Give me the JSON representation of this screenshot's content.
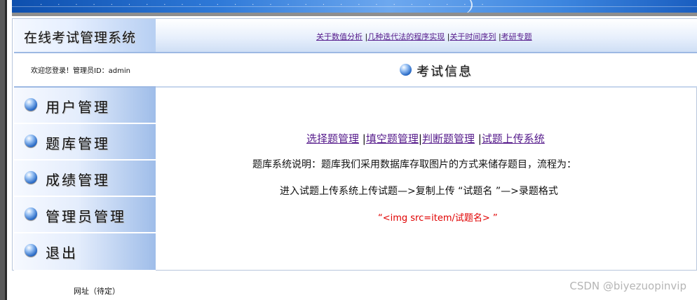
{
  "sidebar": {
    "title": "在线考试管理系统",
    "welcome": "欢迎您登录！管理员ID：admin",
    "items": [
      {
        "label": "用户管理"
      },
      {
        "label": "题库管理"
      },
      {
        "label": "成绩管理"
      },
      {
        "label": "管理员管理"
      },
      {
        "label": "退出"
      }
    ]
  },
  "nav": {
    "links": [
      "关于数值分析",
      "几种迭代法的程序实现",
      "关于时间序列",
      "考研专题"
    ],
    "separator": "|"
  },
  "section": {
    "title": "考试信息"
  },
  "content": {
    "links": [
      "选择题管理",
      "填空题管理",
      "判断题管理",
      "试题上传系统"
    ],
    "description_1": "题库系统说明：题库我们采用数据库存取图片的方式来储存题目，流程为：",
    "description_2": "进入试题上传系统上传试题—>复制上传 “试题名 ”—>录题格式",
    "format_example": "“<img src=item/试题名> ”"
  },
  "footer": {
    "text": "网址（待定）"
  },
  "watermark": "CSDN @biyezuopinvip",
  "colors": {
    "accent_blue": "#2b6cc7",
    "link": "#551a8b",
    "format_red": "#e00000"
  }
}
